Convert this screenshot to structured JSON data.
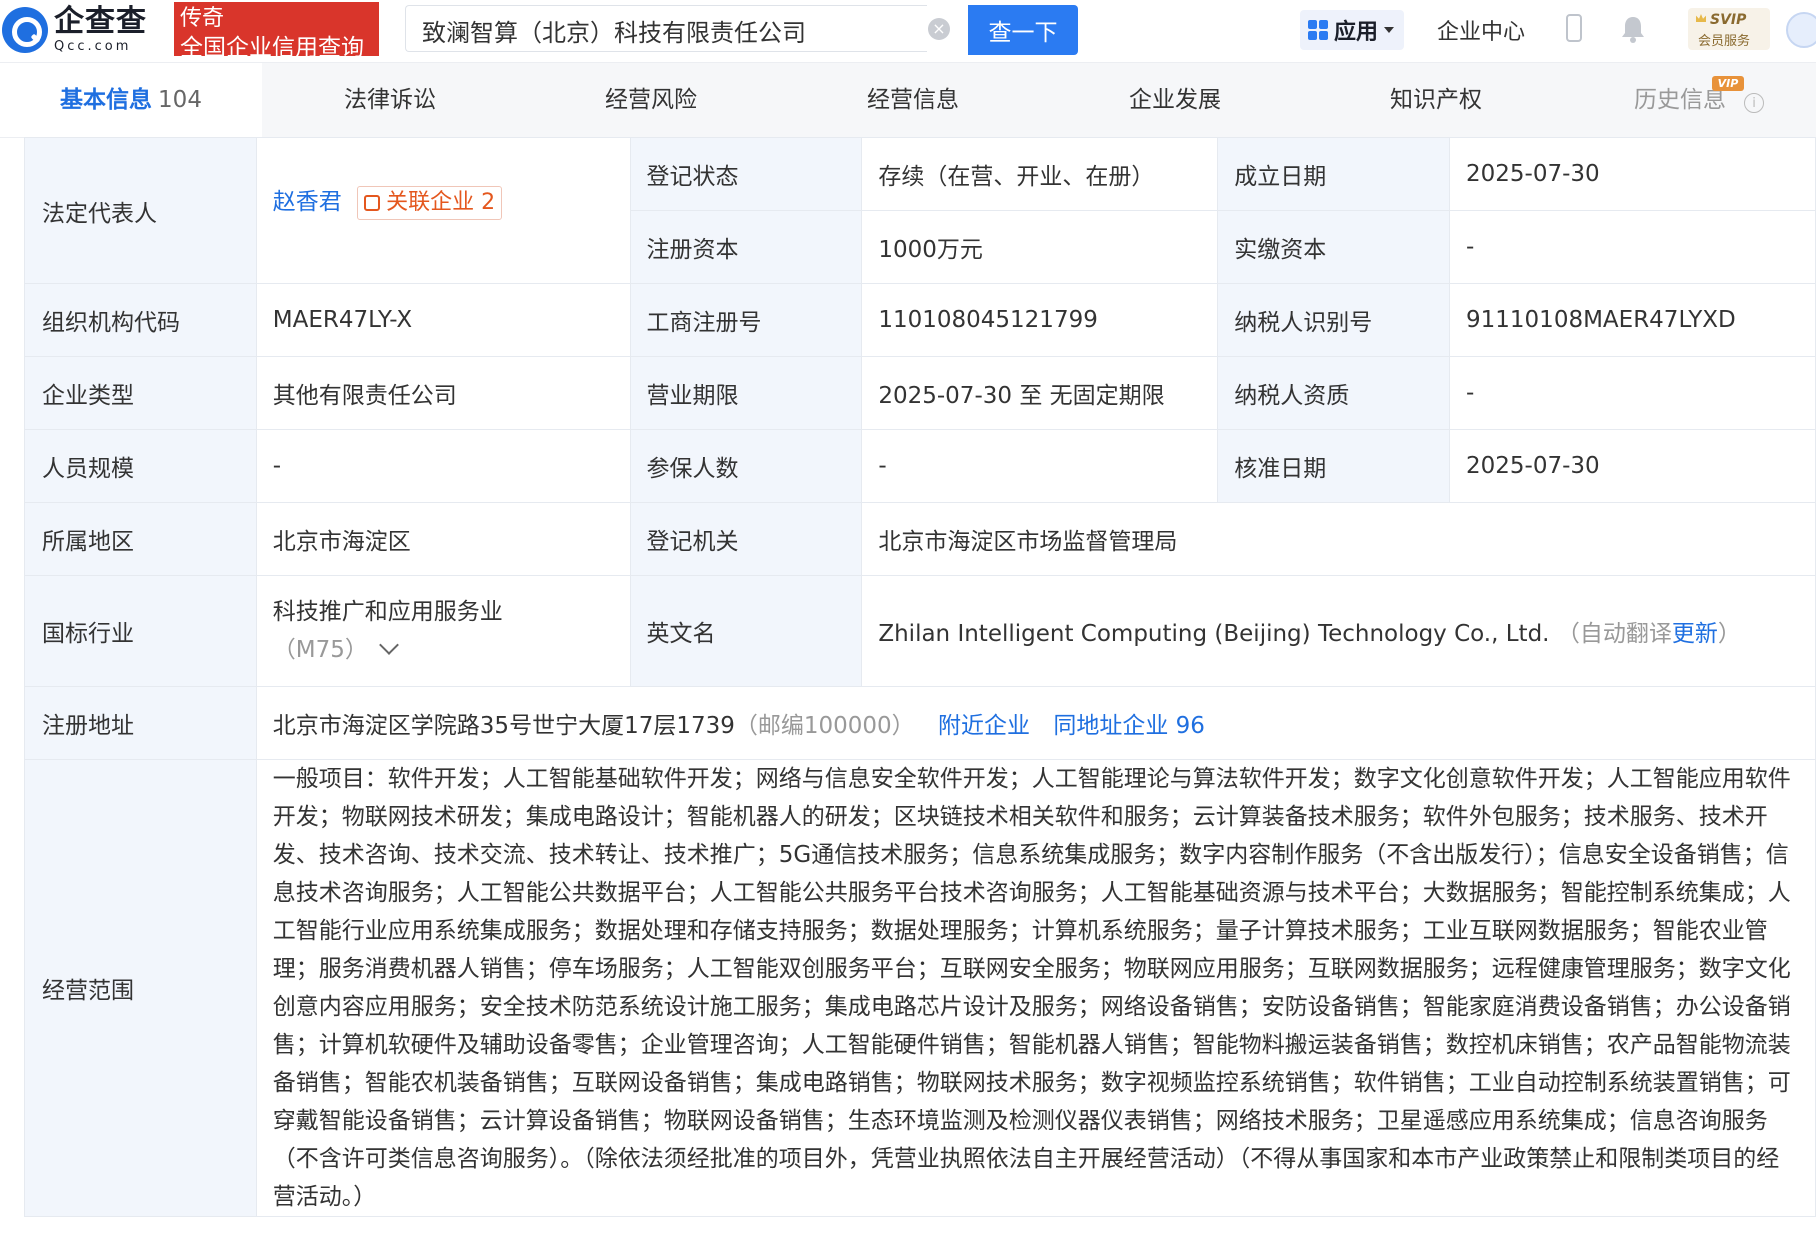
{
  "header": {
    "logo_cn": "企查查",
    "logo_en": "Qcc.com",
    "slogan_line1": "传奇",
    "slogan_line2": "全国企业信用查询",
    "search_value": "致澜智算（北京）科技有限责任公司",
    "search_button": "查一下",
    "apps_label": "应用",
    "enterprise_center": "企业中心",
    "svip_title": "SVIP",
    "svip_sub": "会员服务"
  },
  "tabs": [
    {
      "label": "基本信息",
      "count": "104"
    },
    {
      "label": "法律诉讼"
    },
    {
      "label": "经营风险"
    },
    {
      "label": "经营信息"
    },
    {
      "label": "企业发展"
    },
    {
      "label": "知识产权"
    },
    {
      "label": "历史信息",
      "badge": "VIP"
    }
  ],
  "info": {
    "legal_rep_label": "法定代表人",
    "legal_rep_name": "赵香君",
    "related_label": "关联企业",
    "related_count": "2",
    "reg_status_label": "登记状态",
    "reg_status": "存续（在营、开业、在册）",
    "found_date_label": "成立日期",
    "found_date": "2025-07-30",
    "reg_capital_label": "注册资本",
    "reg_capital": "1000万元",
    "paid_capital_label": "实缴资本",
    "paid_capital": "-",
    "org_code_label": "组织机构代码",
    "org_code": "MAER47LY-X",
    "biz_reg_no_label": "工商注册号",
    "biz_reg_no": "110108045121799",
    "taxpayer_id_label": "纳税人识别号",
    "taxpayer_id": "91110108MAER47LYXD",
    "company_type_label": "企业类型",
    "company_type": "其他有限责任公司",
    "term_label": "营业期限",
    "term": "2025-07-30 至 无固定期限",
    "taxpayer_qual_label": "纳税人资质",
    "taxpayer_qual": "-",
    "staff_size_label": "人员规模",
    "staff_size": "-",
    "insured_label": "参保人数",
    "insured": "-",
    "approved_date_label": "核准日期",
    "approved_date": "2025-07-30",
    "region_label": "所属地区",
    "region": "北京市海淀区",
    "authority_label": "登记机关",
    "authority": "北京市海淀区市场监督管理局",
    "industry_label": "国标行业",
    "industry_name": "科技推广和应用服务业",
    "industry_code": "（M75）",
    "en_name_label": "英文名",
    "en_name": "Zhilan Intelligent Computing (Beijing) Technology Co., Ltd.",
    "en_name_note_prefix": "（自动翻译",
    "en_name_update": "更新",
    "en_name_note_suffix": "）",
    "address_label": "注册地址",
    "address": "北京市海淀区学院路35号世宁大厦17层1739",
    "postcode": "（邮编100000）",
    "nearby_link": "附近企业",
    "same_addr_link": "同地址企业 96",
    "scope_label": "经营范围",
    "scope": "一般项目：软件开发；人工智能基础软件开发；网络与信息安全软件开发；人工智能理论与算法软件开发；数字文化创意软件开发；人工智能应用软件开发；物联网技术研发；集成电路设计；智能机器人的研发；区块链技术相关软件和服务；云计算装备技术服务；软件外包服务；技术服务、技术开发、技术咨询、技术交流、技术转让、技术推广；5G通信技术服务；信息系统集成服务；数字内容制作服务（不含出版发行）；信息安全设备销售；信息技术咨询服务；人工智能公共数据平台；人工智能公共服务平台技术咨询服务；人工智能基础资源与技术平台；大数据服务；智能控制系统集成；人工智能行业应用系统集成服务；数据处理和存储支持服务；数据处理服务；计算机系统服务；量子计算技术服务；工业互联网数据服务；智能农业管理；服务消费机器人销售；停车场服务；人工智能双创服务平台；互联网安全服务；物联网应用服务；互联网数据服务；远程健康管理服务；数字文化创意内容应用服务；安全技术防范系统设计施工服务；集成电路芯片设计及服务；网络设备销售；安防设备销售；智能家庭消费设备销售；办公设备销售；计算机软硬件及辅助设备零售；企业管理咨询；人工智能硬件销售；智能机器人销售；智能物料搬运装备销售；数控机床销售；农产品智能物流装备销售；智能农机装备销售；互联网设备销售；集成电路销售；物联网技术服务；数字视频监控系统销售；软件销售；工业自动控制系统装置销售；可穿戴智能设备销售；云计算设备销售；物联网设备销售；生态环境监测及检测仪器仪表销售；网络技术服务；卫星遥感应用系统集成；信息咨询服务（不含许可类信息咨询服务）。（除依法须经批准的项目外，凭营业执照依法自主开展经营活动）（不得从事国家和本市产业政策禁止和限制类项目的经营活动。）"
  }
}
